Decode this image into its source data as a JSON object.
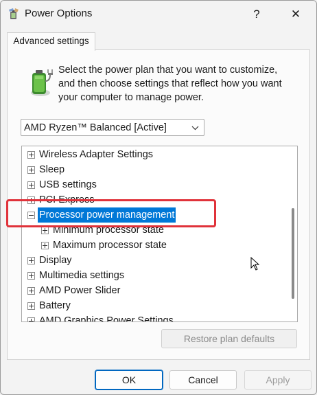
{
  "window": {
    "title": "Power Options",
    "help_glyph": "?",
    "close_glyph": "✕"
  },
  "tabs": [
    {
      "label": "Advanced settings"
    }
  ],
  "description": "Select the power plan that you want to customize, and then choose settings that reflect how you want your computer to manage power.",
  "plan_select": {
    "value": "AMD Ryzen™ Balanced [Active]"
  },
  "tree": {
    "items": [
      {
        "label": "Wireless Adapter Settings",
        "expander": "plus"
      },
      {
        "label": "Sleep",
        "expander": "plus"
      },
      {
        "label": "USB settings",
        "expander": "plus"
      },
      {
        "label": "PCI Express",
        "expander": "plus"
      },
      {
        "label": "Processor power management",
        "expander": "minus",
        "selected": true
      },
      {
        "label": "Minimum processor state",
        "expander": "plus"
      },
      {
        "label": "Maximum processor state",
        "expander": "plus"
      },
      {
        "label": "Display",
        "expander": "plus"
      },
      {
        "label": "Multimedia settings",
        "expander": "plus"
      },
      {
        "label": "AMD Power Slider",
        "expander": "plus"
      },
      {
        "label": "Battery",
        "expander": "plus"
      },
      {
        "label": "AMD Graphics Power Settings",
        "expander": "plus"
      }
    ]
  },
  "buttons": {
    "restore": "Restore plan defaults",
    "ok": "OK",
    "cancel": "Cancel",
    "apply": "Apply"
  },
  "colors": {
    "selection": "#0078d7",
    "highlight_border": "#e0323a",
    "accent": "#0067c0"
  }
}
